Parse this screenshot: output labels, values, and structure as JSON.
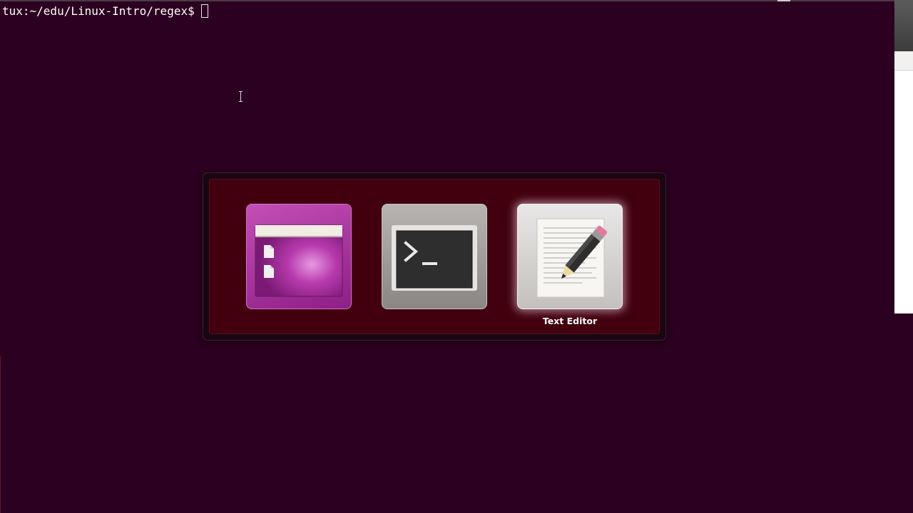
{
  "terminal": {
    "prompt": "tux:~/edu/Linux-Intro/regex$"
  },
  "switcher": {
    "apps": [
      {
        "name": "files-icon",
        "label": "",
        "selected": false
      },
      {
        "name": "terminal-icon",
        "label": "",
        "selected": false
      },
      {
        "name": "text-editor-icon",
        "label": "Text Editor",
        "selected": true
      }
    ]
  },
  "colors": {
    "desktop_bg": "#2c0020",
    "switcher_bg": "#42000e",
    "files_tile": "#b040a6",
    "terminal_tile": "#a09c9a",
    "editor_tile": "#dcdada"
  }
}
